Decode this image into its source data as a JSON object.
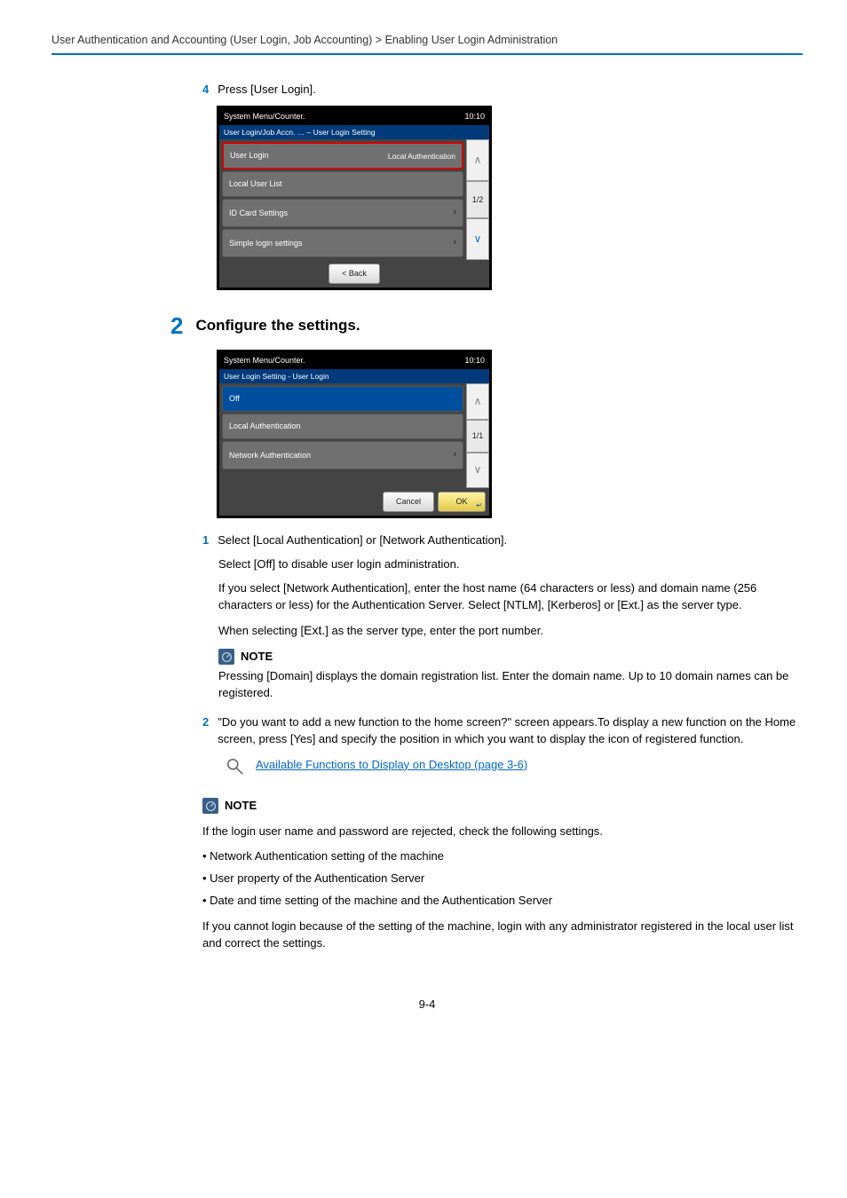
{
  "header": "User Authentication and Accounting (User Login, Job Accounting) > Enabling User Login Administration",
  "step4": {
    "num": "4",
    "text": "Press [User Login]."
  },
  "panel1": {
    "title": "System Menu/Counter.",
    "time": "10:10",
    "crumb": "User Login/Job Accn. … – User Login Setting",
    "rows": [
      {
        "label": "User Login",
        "value": "Local Authentication"
      },
      {
        "label": "Local User List",
        "value": ""
      },
      {
        "label": "ID Card Settings",
        "value": "›"
      },
      {
        "label": "Simple login settings",
        "value": "›"
      }
    ],
    "page": "1/2",
    "back": "< Back"
  },
  "bigstep": {
    "num": "2",
    "title": "Configure the settings."
  },
  "panel2": {
    "title": "System Menu/Counter.",
    "time": "10:10",
    "crumb": "User Login Setting - User Login",
    "rows": [
      {
        "label": "Off"
      },
      {
        "label": "Local Authentication"
      },
      {
        "label": "Network Authentication",
        "value": "›"
      }
    ],
    "page": "1/1",
    "cancel": "Cancel",
    "ok": "OK"
  },
  "sub1": {
    "num": "1",
    "line": "Select [Local Authentication] or [Network Authentication].",
    "p1": "Select [Off] to disable user login administration.",
    "p2": "If you select [Network Authentication], enter the host name (64 characters or less) and domain name (256 characters or less) for the Authentication Server. Select [NTLM], [Kerberos] or [Ext.] as the server type.",
    "p3_a": "When selecting [",
    "p3_b": "Ext.",
    "p3_c": "] as the server type, enter the port number."
  },
  "note1": {
    "label": "NOTE",
    "text": "Pressing [Domain] displays the domain registration list. Enter the domain name. Up to 10 domain names can be registered."
  },
  "sub2": {
    "num": "2",
    "text": "\"Do you want to add a new function to the home screen?\" screen appears.To display a new function on the Home screen, press [Yes] and specify the position in which you want to display the icon of registered function."
  },
  "reference": "Available Functions to Display on Desktop (page 3-6)",
  "note2": {
    "label": "NOTE",
    "intro": "If the login user name and password are rejected, check the following settings.",
    "bullets": [
      "Network Authentication setting of the machine",
      "User property of the Authentication Server",
      "Date and time setting of the machine and the Authentication Server"
    ],
    "outro": "If you cannot login because of the setting of the machine, login with any administrator registered in the local user list and correct the settings."
  },
  "pagenum": "9-4"
}
